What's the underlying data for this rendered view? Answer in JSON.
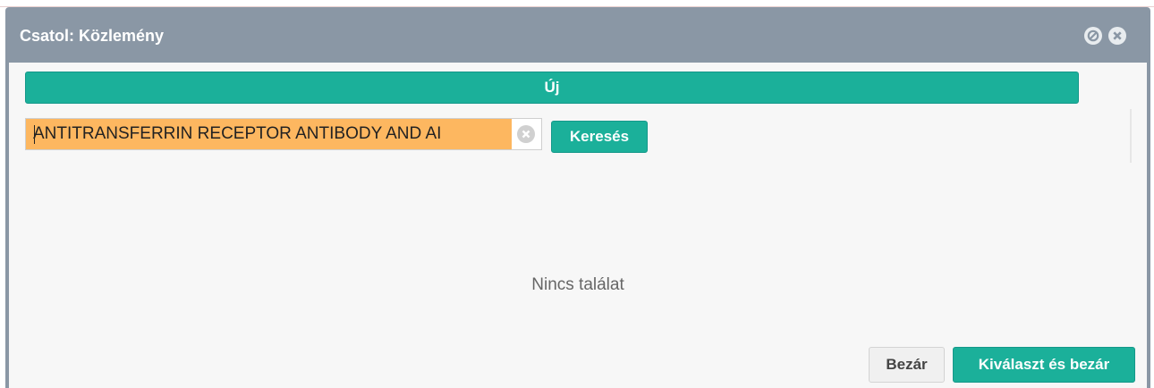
{
  "dialog": {
    "title": "Csatol: Közlemény",
    "title_icons": [
      "block-icon",
      "close-icon"
    ]
  },
  "toolbar": {
    "new_label": "Új"
  },
  "search": {
    "value": "ANTITRANSFERRIN RECEPTOR ANTIBODY AND AI",
    "clear_icon": "clear-icon",
    "button_label": "Keresés"
  },
  "results": {
    "empty_message": "Nincs találat"
  },
  "footer": {
    "close_label": "Bezár",
    "select_close_label": "Kiválaszt és bezár"
  },
  "colors": {
    "accent": "#1bb09a",
    "titlebar": "#8a97a5",
    "search_highlight": "#fdb760"
  }
}
